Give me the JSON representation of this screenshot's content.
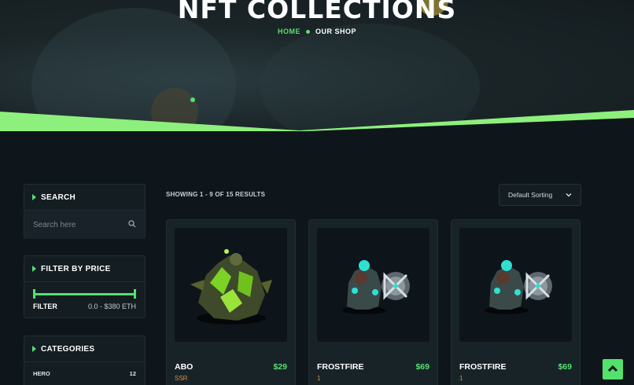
{
  "hero": {
    "title": "NFT COLLECTIONS",
    "breadcrumb": {
      "home": "HOME",
      "current": "OUR SHOP"
    }
  },
  "sidebar": {
    "search": {
      "title": "SEARCH",
      "placeholder": "Search here",
      "icon": "search-icon"
    },
    "price": {
      "title": "FILTER BY PRICE",
      "filter_label": "FILTER",
      "range": "0.0 - $380 ETH"
    },
    "categories": {
      "title": "CATEGORIES",
      "items": [
        {
          "label": "HERO",
          "count": "12"
        }
      ]
    }
  },
  "toolbar": {
    "results": "SHOWING 1 - 9 OF 15 RESULTS",
    "sort": "Default Sorting",
    "sort_icon": "chevron-down-icon"
  },
  "products": [
    {
      "name": "ABO",
      "price": "$29",
      "sub": "SSR"
    },
    {
      "name": "FROSTFIRE",
      "price": "$69",
      "sub": "1"
    },
    {
      "name": "FROSTFIRE",
      "price": "$69",
      "sub": "1"
    }
  ],
  "colors": {
    "accent": "#53e26c",
    "background": "#0f161b",
    "card": "#182328",
    "rarity": "#e08a2e"
  },
  "back_to_top": {
    "icon": "chevron-up-icon"
  }
}
